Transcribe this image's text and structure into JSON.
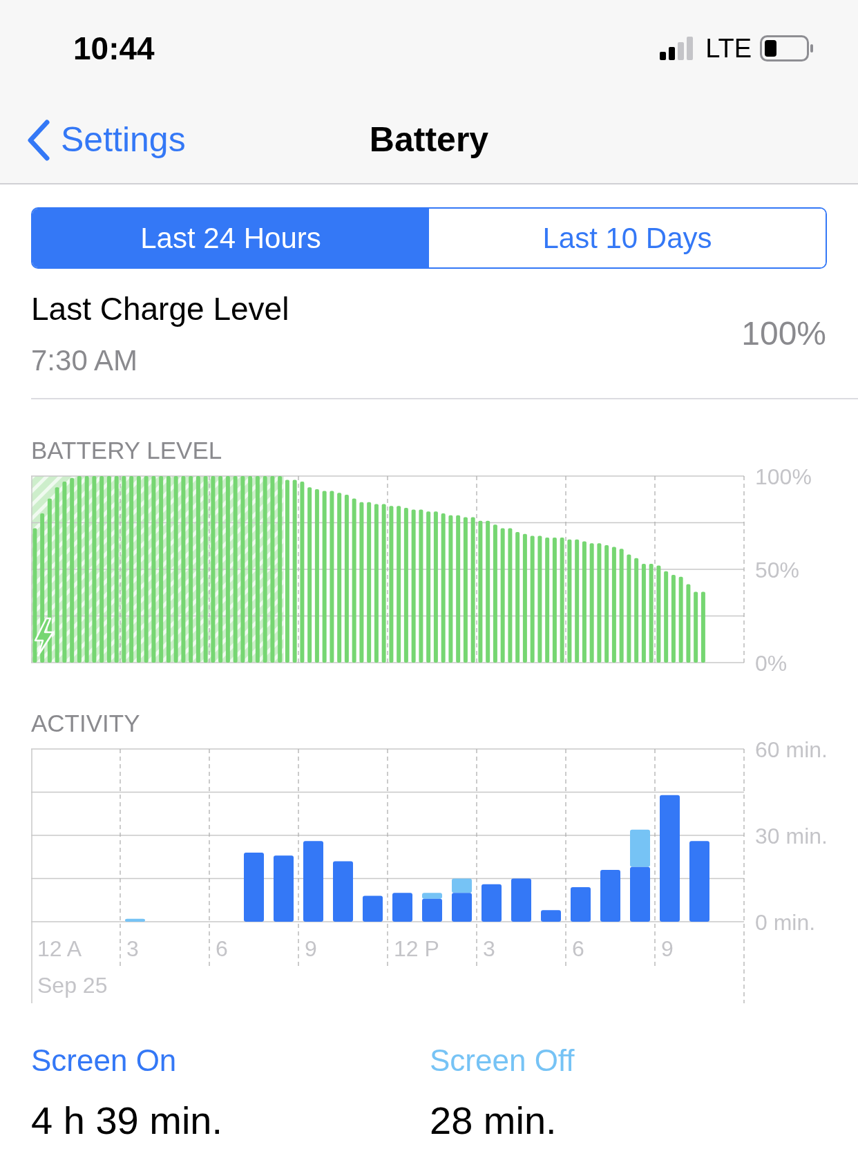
{
  "status_bar": {
    "time": "10:44",
    "network": "LTE"
  },
  "nav": {
    "back": "Settings",
    "title": "Battery"
  },
  "tabs": [
    {
      "label": "Last 24 Hours",
      "selected": true
    },
    {
      "label": "Last 10 Days",
      "selected": false
    }
  ],
  "last_charge": {
    "title": "Last Charge Level",
    "time": "7:30 AM",
    "value": "100%"
  },
  "battery_level": {
    "heading": "BATTERY LEVEL",
    "charging": true,
    "chart_data": {
      "type": "bar",
      "ylim": [
        0,
        100
      ],
      "yticks": [
        {
          "value": 0,
          "label": "0%"
        },
        {
          "value": 50,
          "label": "50%"
        },
        {
          "value": 100,
          "label": "100%"
        }
      ],
      "series": [
        {
          "color": "#76d672",
          "values": [
            72,
            80,
            88,
            94,
            97,
            99,
            100,
            100,
            100,
            100,
            100,
            100,
            100,
            100,
            100,
            100,
            100,
            100,
            100,
            100,
            100,
            100,
            100,
            100,
            100,
            100,
            100,
            100,
            100,
            100,
            100,
            100,
            100,
            100,
            98,
            98,
            97,
            94,
            93,
            92,
            92,
            91,
            90,
            88,
            86,
            86,
            85,
            85,
            84,
            84,
            83,
            82,
            82,
            81,
            81,
            80,
            79,
            79,
            78,
            78,
            76,
            76,
            74,
            72,
            72,
            70,
            69,
            68,
            68,
            67,
            67,
            67,
            66,
            66,
            65,
            64,
            64,
            63,
            62,
            61,
            58,
            56,
            53,
            53,
            52,
            49,
            47,
            46,
            42,
            38,
            38
          ]
        }
      ]
    }
  },
  "activity": {
    "heading": "ACTIVITY",
    "x_labels": [
      "12 A",
      "3",
      "6",
      "9",
      "12 P",
      "3",
      "6",
      "9"
    ],
    "date_label": "Sep 25",
    "chart_data": {
      "type": "bar",
      "stacked": true,
      "ylim": [
        0,
        60
      ],
      "yticks": [
        {
          "value": 0,
          "label": "0 min."
        },
        {
          "value": 30,
          "label": "30 min."
        },
        {
          "value": 60,
          "label": "60 min."
        }
      ],
      "series": [
        {
          "name": "Screen On",
          "color": "#3478f6",
          "values": [
            0,
            0,
            0,
            0,
            0,
            0,
            0,
            24,
            23,
            28,
            21,
            9,
            10,
            8,
            10,
            13,
            15,
            4,
            12,
            18,
            19,
            44,
            28,
            null
          ]
        },
        {
          "name": "Screen Off",
          "color": "#76c3f5",
          "values": [
            0,
            0,
            0,
            1,
            0,
            0,
            0,
            0,
            0,
            0,
            0,
            0,
            0,
            2,
            5,
            0,
            0,
            0,
            0,
            0,
            13,
            0,
            0,
            null
          ]
        }
      ]
    }
  },
  "totals": [
    {
      "value": "4 h 39 min."
    },
    {
      "value": "28 min."
    }
  ]
}
